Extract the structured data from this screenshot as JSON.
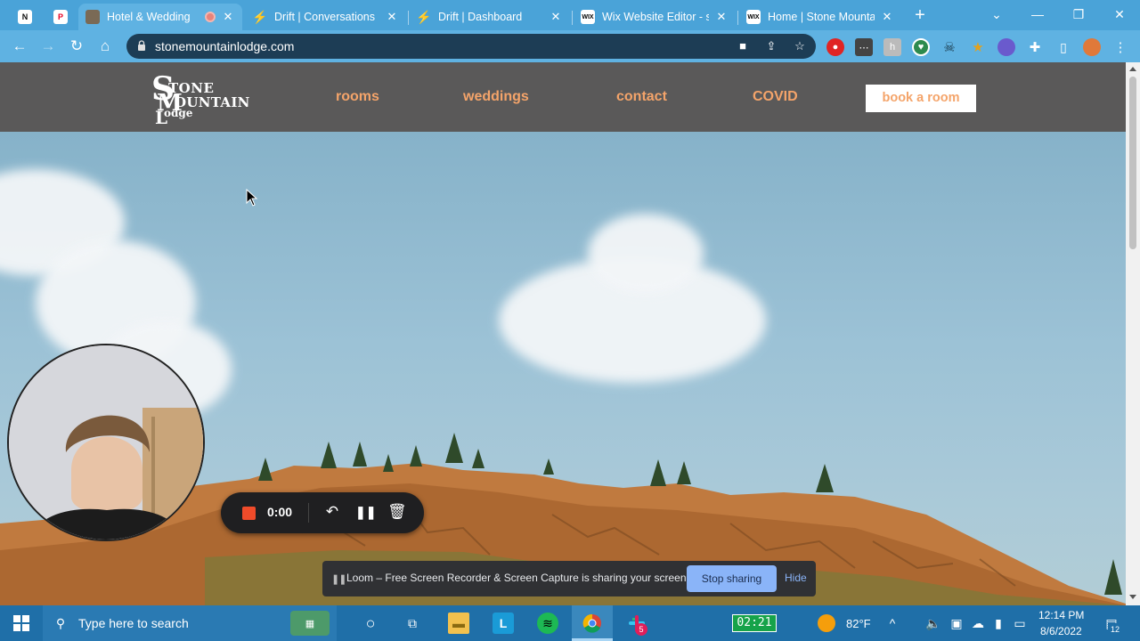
{
  "browser": {
    "tabs": [
      {
        "title": "",
        "icon": "notion-icon",
        "pinned": true
      },
      {
        "title": "",
        "icon": "pinterest-icon",
        "pinned": true
      },
      {
        "title": "Hotel & Wedding",
        "icon": "site-favicon",
        "active": true,
        "recording": true
      },
      {
        "title": "Drift | Conversations",
        "icon": "drift-icon"
      },
      {
        "title": "Drift | Dashboard",
        "icon": "drift-icon"
      },
      {
        "title": "Wix Website Editor - st",
        "icon": "wix-icon"
      },
      {
        "title": "Home | Stone Mountai",
        "icon": "wix-icon"
      }
    ],
    "close_glyph": "✕",
    "new_tab_glyph": "+",
    "url": "stonemountainlodge.com"
  },
  "site": {
    "logo": {
      "initial_s": "S",
      "word1": "TONE",
      "initial_m": "M",
      "word2": "OUNTAIN",
      "initial_l": "L",
      "word3": "odge"
    },
    "nav": [
      "rooms",
      "weddings",
      "contact",
      "COVID"
    ],
    "book_button": "book a room",
    "accent_color": "#f4a46a",
    "header_color": "#5a5959"
  },
  "loom": {
    "timer": "0:00",
    "share_message": "Loom – Free Screen Recorder & Screen Capture is sharing your screen.",
    "stop_sharing": "Stop sharing",
    "hide": "Hide",
    "record_color": "#f04b2a"
  },
  "taskbar": {
    "search_placeholder": "Type here to search",
    "timer": "02:21",
    "temperature": "82°F",
    "time": "12:14 PM",
    "date": "8/6/2022",
    "notifications": "12",
    "slack_badge": "5"
  }
}
